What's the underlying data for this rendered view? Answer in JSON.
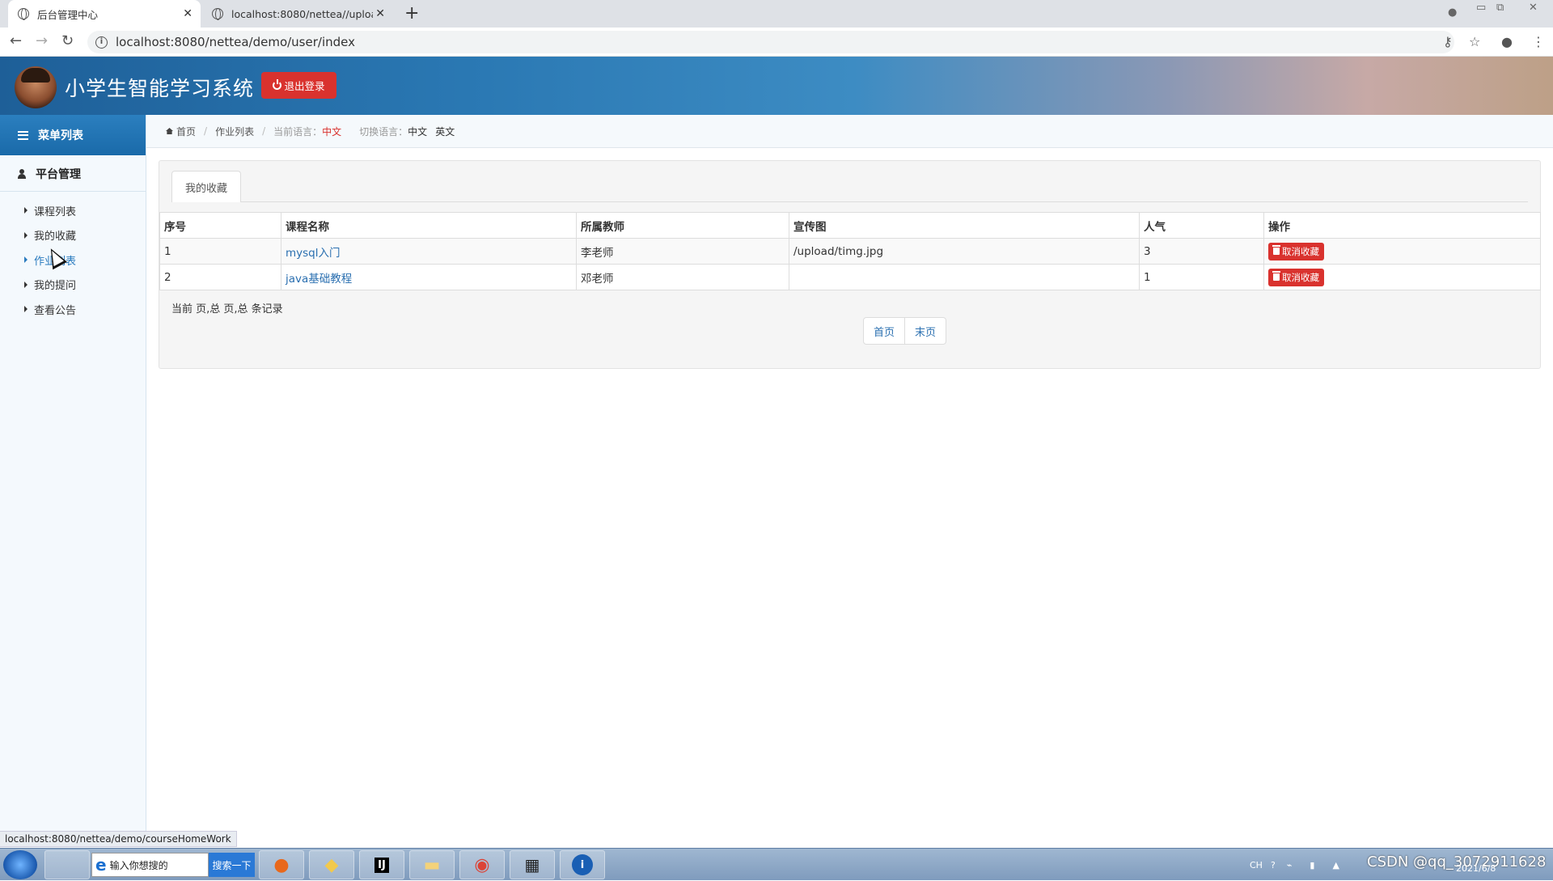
{
  "browser": {
    "tabs": [
      {
        "title": "后台管理中心",
        "active": true
      },
      {
        "title": "localhost:8080/nettea//uploa",
        "active": false
      }
    ],
    "url": "localhost:8080/nettea/demo/user/index",
    "status_url": "localhost:8080/nettea/demo/courseHomeWork"
  },
  "header": {
    "title": "小学生智能学习系统",
    "logout_label": "退出登录"
  },
  "sidebar": {
    "menu_title": "菜单列表",
    "group_title": "平台管理",
    "items": [
      {
        "label": "课程列表",
        "active": false
      },
      {
        "label": "我的收藏",
        "active": false
      },
      {
        "label": "作业列表",
        "active": true
      },
      {
        "label": "我的提问",
        "active": false
      },
      {
        "label": "查看公告",
        "active": false
      }
    ]
  },
  "breadcrumb": {
    "home": "首页",
    "current": "作业列表",
    "lang_label": "当前语言：",
    "lang_value": "中文",
    "switch_label": "切换语言：",
    "switch_zh": "中文",
    "switch_en": "英文"
  },
  "panel": {
    "tab_label": "我的收藏",
    "columns": [
      "序号",
      "课程名称",
      "所属教师",
      "宣传图",
      "人气",
      "操作"
    ],
    "rows": [
      {
        "index": "1",
        "course": "mysql入门",
        "teacher": "李老师",
        "image": "/upload/timg.jpg",
        "popularity": "3",
        "action": "取消收藏"
      },
      {
        "index": "2",
        "course": "java基础教程",
        "teacher": "邓老师",
        "image": "",
        "popularity": "1",
        "action": "取消收藏"
      }
    ],
    "page_info": "当前 页,总 页,总 条记录",
    "pager": {
      "first": "首页",
      "last": "末页"
    }
  },
  "taskbar": {
    "search_placeholder": "输入你想搜的",
    "search_button": "搜索一下",
    "tray_lang": "CH",
    "watermark": "CSDN @qq_3072911628",
    "date": "2021/6/8"
  },
  "colors": {
    "header_start": "#1e5f98",
    "accent": "#2a7bbf",
    "danger": "#d9322e"
  }
}
